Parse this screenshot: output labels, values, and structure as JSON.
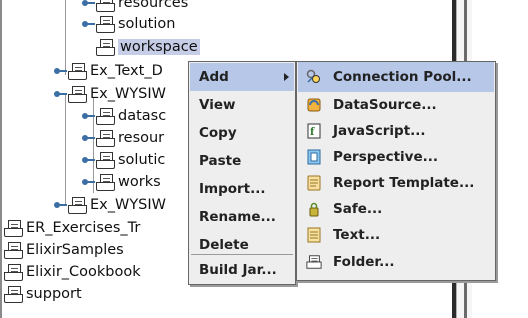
{
  "tree": {
    "items": [
      {
        "label": "resources",
        "indent": 2,
        "handle": true
      },
      {
        "label": "solution",
        "indent": 2,
        "handle": true
      },
      {
        "label": "workspace",
        "indent": 2,
        "handle": false,
        "selected": true
      },
      {
        "label": "Ex_Text_D",
        "indent": 1,
        "handle": true
      },
      {
        "label": "Ex_WYSIW",
        "indent": 1,
        "handle": true,
        "open": true
      },
      {
        "label": "datasc",
        "indent": 2,
        "handle": true
      },
      {
        "label": "resour",
        "indent": 2,
        "handle": true
      },
      {
        "label": "solutic",
        "indent": 2,
        "handle": true
      },
      {
        "label": "works",
        "indent": 2,
        "handle": true
      },
      {
        "label": "Ex_WYSIW",
        "indent": 1,
        "handle": true
      },
      {
        "label": "ER_Exercises_Tr",
        "indent": 0,
        "handle": false
      },
      {
        "label": "ElixirSamples",
        "indent": 0,
        "handle": false
      },
      {
        "label": "Elixir_Cookbook",
        "indent": 0,
        "handle": false
      },
      {
        "label": "support",
        "indent": 0,
        "handle": false
      }
    ]
  },
  "context_menu": {
    "items": [
      {
        "label": "Add",
        "submenu": true,
        "active": true
      },
      {
        "label": "View"
      },
      {
        "label": "Copy"
      },
      {
        "label": "Paste"
      },
      {
        "label": "Import..."
      },
      {
        "label": "Rename..."
      },
      {
        "label": "Delete"
      },
      {
        "label": "Build Jar...",
        "separator_before": true
      }
    ]
  },
  "add_submenu": {
    "items": [
      {
        "label": "Connection Pool...",
        "icon": "connection-pool-icon",
        "active": true
      },
      {
        "label": "DataSource...",
        "icon": "datasource-icon"
      },
      {
        "label": "JavaScript...",
        "icon": "javascript-icon"
      },
      {
        "label": "Perspective...",
        "icon": "perspective-icon"
      },
      {
        "label": "Report Template...",
        "icon": "report-template-icon"
      },
      {
        "label": "Safe...",
        "icon": "safe-icon"
      },
      {
        "label": "Text...",
        "icon": "text-icon"
      },
      {
        "label": "Folder...",
        "icon": "folder-icon"
      }
    ]
  },
  "colors": {
    "menu_bg": "#eeeeee",
    "highlight": "#b6c7e8",
    "tree_selection": "#c6cde6"
  }
}
